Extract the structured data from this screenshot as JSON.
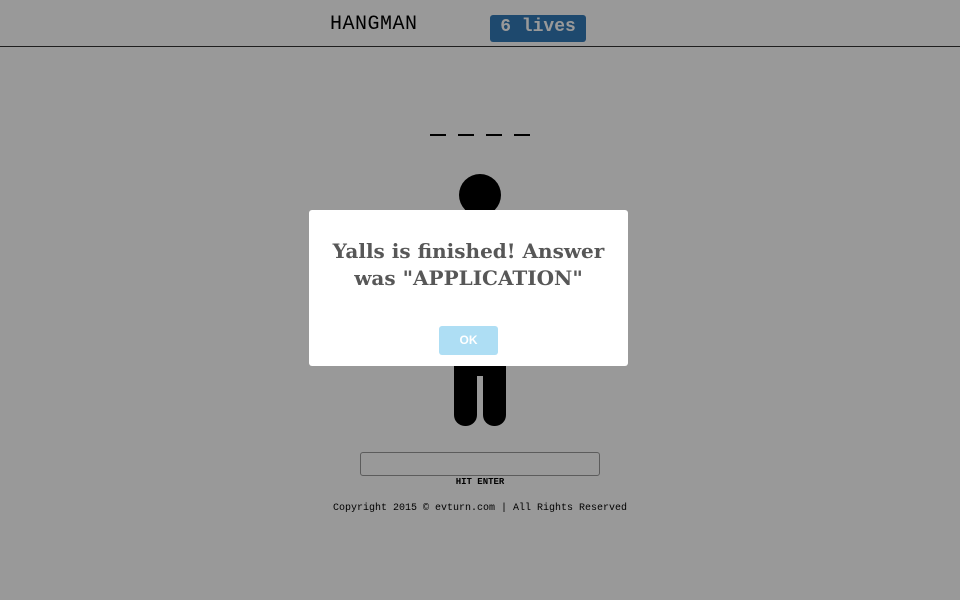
{
  "app": {
    "title": "HANGMAN",
    "lives_label": "6 lives"
  },
  "game": {
    "revealed_letters": [
      "",
      "",
      "",
      ""
    ]
  },
  "input": {
    "value": "",
    "hint": "HIT ENTER"
  },
  "footer": {
    "text": "Copyright 2015 © evturn.com | All Rights Reserved"
  },
  "dialog": {
    "message": "Yalls is finished! Answer was \"APPLICATION\"",
    "ok_label": "OK"
  },
  "colors": {
    "lives_badge": "#337ab7",
    "ok_button": "#aedef4",
    "overlay": "rgba(0,0,0,0.4)",
    "dialog_text": "#575757"
  },
  "icons": {
    "hangman_figure": "hangman-figure"
  }
}
